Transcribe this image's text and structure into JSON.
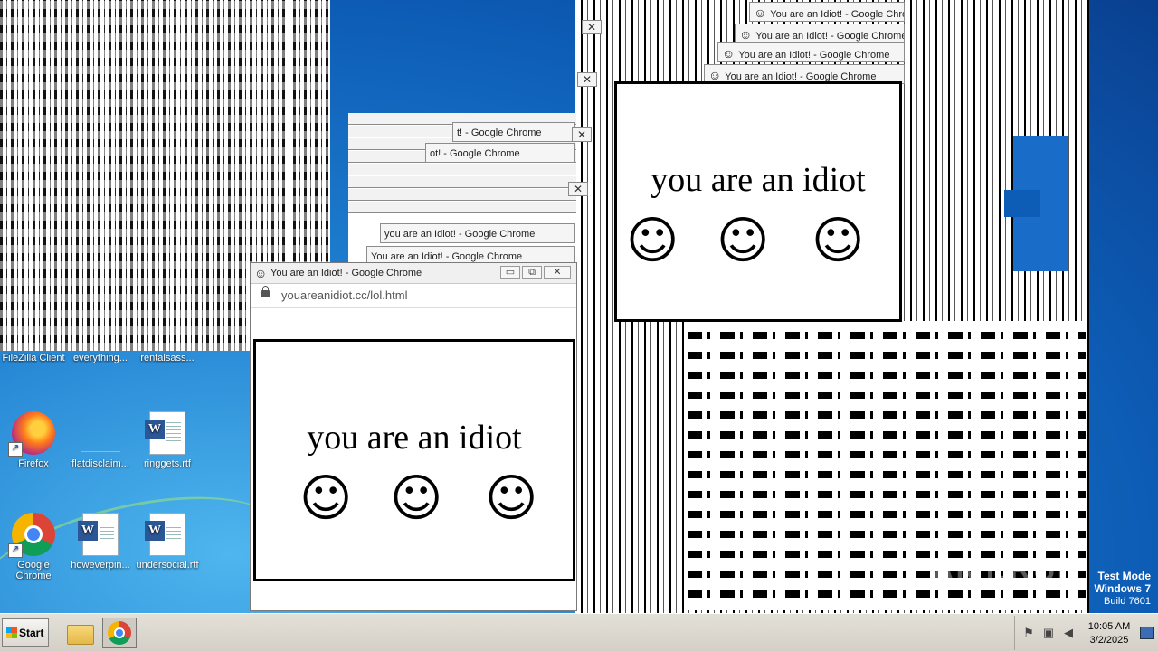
{
  "popup_title": "You are an Idiot! - Google Chrome",
  "address_bar": "youareanidiot.cc/lol.html",
  "page_message": "you are an idiot",
  "window_buttons": {
    "minimize": "▭",
    "restore": "⧉",
    "close": "✕"
  },
  "stack_titles": [
    "You are an Idiot! - Google Chrome",
    "You are an Idiot! - Google Chrome",
    "You are an Idiot! - Google Chrome",
    "You are an Idiot! - Google Chrome"
  ],
  "mid_stack_titles": [
    "t! - Google Chrome",
    "ot! - Google Chrome",
    "you are an Idiot! - Google Chrome",
    "You are an Idiot! - Google Chrome"
  ],
  "desktop_icons": {
    "filezilla": "FileZilla Client",
    "everything": "everything...",
    "rentalsass": "rentalsass...",
    "firefox": "Firefox",
    "flatdisclaim": "flatdisclaim...",
    "ringgets": "ringgets.rtf",
    "chrome": "Google Chrome",
    "howeverpin": "howeverpin...",
    "undersocial": "undersocial.rtf"
  },
  "taskbar": {
    "start_label": "Start",
    "time": "10:05 AM",
    "date": "3/2/2025"
  },
  "watermark": {
    "mode": "Test Mode",
    "os": "Windows 7",
    "build": "Build 7601",
    "brand": "ANY.RUN"
  },
  "icons": [
    "smiley-icon",
    "lock-icon",
    "windows-flag-icon",
    "folder-icon",
    "chrome-icon",
    "firefox-icon",
    "word-doc-icon",
    "flag-icon",
    "network-icon",
    "speaker-icon"
  ]
}
